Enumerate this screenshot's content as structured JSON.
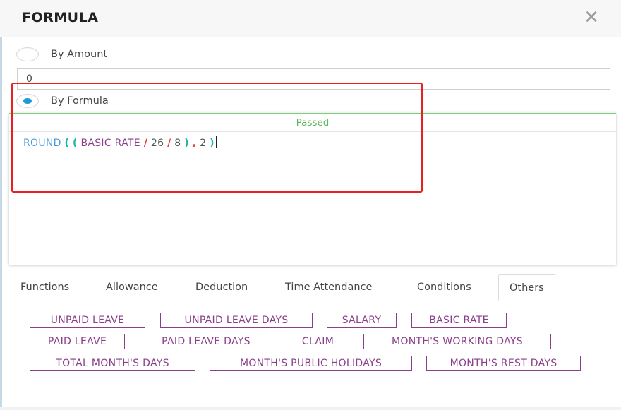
{
  "modal": {
    "title": "FORMULA",
    "close_icon": "close-icon"
  },
  "options": {
    "by_amount": {
      "label": "By Amount",
      "checked": false
    },
    "amount_value": "0",
    "by_formula": {
      "label": "By Formula",
      "checked": true
    }
  },
  "editor": {
    "status": "Passed",
    "status_color": "#5cb85c",
    "tokens": {
      "fn": "ROUND",
      "paren1": "(",
      "paren2": "(",
      "var": "BASIC RATE",
      "op1": "/",
      "num1": "26",
      "op2": "/",
      "num2": "8",
      "paren3": ")",
      "comma": ",",
      "num3": "2",
      "paren4": ")"
    }
  },
  "tabs": [
    "Functions",
    "Allowance",
    "Deduction",
    "Time Attendance",
    "Conditions",
    "Others"
  ],
  "active_tab": "Others",
  "chips": [
    "UNPAID LEAVE",
    "UNPAID LEAVE DAYS",
    "SALARY",
    "BASIC RATE",
    "PAID LEAVE",
    "PAID LEAVE DAYS",
    "CLAIM",
    "MONTH'S WORKING DAYS",
    "TOTAL MONTH'S DAYS",
    "MONTH'S PUBLIC HOLIDAYS",
    "MONTH'S REST DAYS"
  ],
  "colors": {
    "chip": "#8a3f8a",
    "radio_checked": "#1f9ad6",
    "highlight": "#e82020",
    "function_token": "#4a9bd8",
    "paren_token": "#1bb5a8",
    "operator_token": "#e23b3b"
  }
}
